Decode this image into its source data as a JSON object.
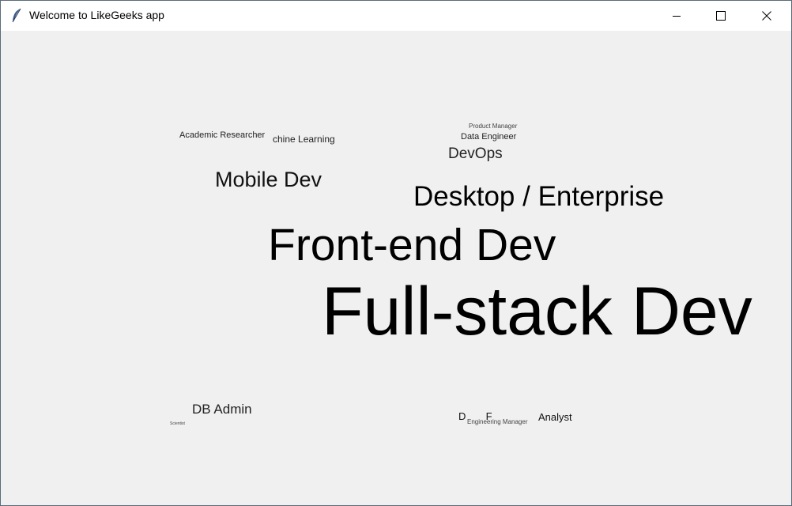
{
  "window": {
    "title": "Welcome to LikeGeeks app",
    "icon": "feather-icon",
    "controls": [
      "minimize-icon",
      "maximize-icon",
      "close-icon"
    ]
  },
  "word_cloud": [
    {
      "id": "full-stack",
      "text": "Full-stack Dev"
    },
    {
      "id": "front-end",
      "text": "Front-end Dev"
    },
    {
      "id": "desktop",
      "text": "Desktop / Enterprise"
    },
    {
      "id": "mobile",
      "text": "Mobile Dev"
    },
    {
      "id": "devops",
      "text": "DevOps"
    },
    {
      "id": "data-engineer",
      "text": "Data Engineer"
    },
    {
      "id": "product-manager",
      "text": "Product Manager"
    },
    {
      "id": "machine-learning",
      "text": "chine Learning"
    },
    {
      "id": "academic-researcher",
      "text": "Academic Researcher"
    },
    {
      "id": "db-admin",
      "text": "DB Admin"
    },
    {
      "id": "scientist",
      "text": "Scientist"
    },
    {
      "id": "analyst",
      "text": "Analyst"
    },
    {
      "id": "engineering-manager",
      "text": "Engineering Manager"
    },
    {
      "id": "overlap-fragment",
      "text": "D       F       "
    }
  ]
}
